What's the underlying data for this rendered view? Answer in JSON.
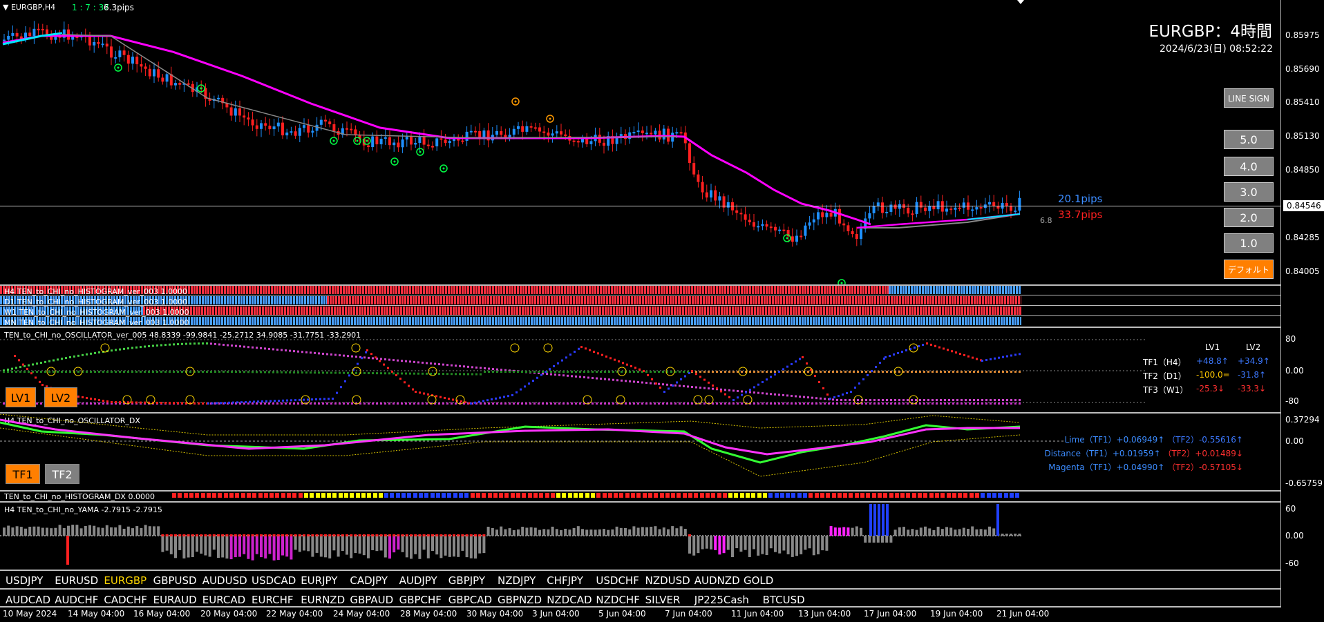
{
  "window": {
    "symbol_tf": "EURGBP,H4",
    "counter": "1 : 7 : 37",
    "pips": "6.3pips"
  },
  "header": {
    "title": "EURGBP：4時間",
    "datetime": "2024/6/23(日) 08:52:22"
  },
  "price_axis": [
    "0.85975",
    "0.85690",
    "0.85410",
    "0.85130",
    "0.84850",
    "0.84546",
    "0.84285",
    "0.84005"
  ],
  "current_price": "0.84546",
  "pips_labels": {
    "blue": "20.1pips",
    "red": "33.7pips",
    "gray": "6.8"
  },
  "buttons": {
    "line_sign": "LINE SIGN",
    "levels": [
      "5.0",
      "4.0",
      "3.0",
      "2.0",
      "1.0"
    ],
    "default": "デフォルト"
  },
  "histogram_rows": [
    {
      "label": "H4 TEN_to_CHI_no_HISTOGRAM_ver_003 1.0000"
    },
    {
      "label": "D1 TEN_to_CHI_no_HISTOGRAM_ver_003 1.0000"
    },
    {
      "label": "W1 TEN_to_CHI_no_HISTOGRAM_ver_003 1.0000"
    },
    {
      "label": "MN TEN_to_CHI_no_HISTOGRAM_ver_003 1.0000"
    }
  ],
  "oscillator": {
    "title": "TEN_to_CHI_no_OSCILLATOR_ver_005 48.8339 -99.9841 -25.2712 34.9085 -31.7751 -33.2901",
    "axis": [
      "80",
      "0.00",
      "-80"
    ],
    "lv_buttons": [
      "LV1",
      "LV2"
    ],
    "table_header": [
      "LV1",
      "LV2"
    ],
    "rows": [
      {
        "label": "TF1（H4）",
        "lv1": "+48.8↑",
        "lv2": "+34.9↑",
        "c1": "#3c78ff",
        "c2": "#3c78ff"
      },
      {
        "label": "TF2（D1）",
        "lv1": "-100.0=",
        "lv2": "-31.8↑",
        "c1": "#ffc800",
        "c2": "#3c78ff"
      },
      {
        "label": "TF3（W1）",
        "lv1": "-25.3↓",
        "lv2": "-33.3↓",
        "c1": "#ff3030",
        "c2": "#ff3030"
      }
    ]
  },
  "dx": {
    "title": "H4 TEN_to_CHI_no_OSCILLATOR_DX",
    "axis": [
      "0.37294",
      "0.00",
      "-0.65759"
    ],
    "tf_buttons": [
      "TF1",
      "TF2"
    ],
    "rows": [
      {
        "name": "Lime（TF1）",
        "tf1": "+0.06949↑",
        "tf2": "（TF2）-0.55616↑",
        "c2": "#3c78ff"
      },
      {
        "name": "Distance（TF1）",
        "tf1": "+0.01959↑",
        "tf2": "（TF2）+0.01489↓",
        "c2": "#ff3030"
      },
      {
        "name": "Magenta（TF1）",
        "tf1": "+0.04990↑",
        "tf2": "（TF2）-0.57105↓",
        "c2": "#ff3030"
      }
    ]
  },
  "histogram_dx": {
    "title": "TEN_to_CHI_no_HISTOGRAM_DX 0.0000"
  },
  "yama": {
    "title": "H4 TEN_to_CHI_no_YAMA -2.7915 -2.7915",
    "axis": [
      "60",
      "0.00",
      "-60"
    ]
  },
  "symbols_row1": [
    "USDJPY",
    "EURUSD",
    "EURGBP",
    "GBPUSD",
    "AUDUSD",
    "USDCAD",
    "EURJPY",
    "CADJPY",
    "AUDJPY",
    "GBPJPY",
    "NZDJPY",
    "CHFJPY",
    "USDCHF",
    "NZDUSD",
    "AUDNZD",
    "GOLD"
  ],
  "symbols_row2": [
    "AUDCAD",
    "AUDCHF",
    "CADCHF",
    "EURAUD",
    "EURCAD",
    "EURCHF",
    "EURNZD",
    "GBPAUD",
    "GBPCHF",
    "GBPCAD",
    "GBPNZD",
    "NZDCAD",
    "NZDCHF",
    "SILVER",
    "JP225Cash",
    "BTCUSD"
  ],
  "active_symbol": "EURGBP",
  "time_axis": [
    "10 May 2024",
    "14 May 04:00",
    "16 May 04:00",
    "20 May 04:00",
    "22 May 04:00",
    "24 May 04:00",
    "28 May 04:00",
    "30 May 04:00",
    "3 Jun 04:00",
    "5 Jun 04:00",
    "7 Jun 04:00",
    "11 Jun 04:00",
    "13 Jun 04:00",
    "17 Jun 04:00",
    "19 Jun 04:00",
    "21 Jun 04:00"
  ],
  "colors": {
    "bull": "#1e90ff",
    "bear": "#ff2020",
    "ma": "#ff00ff",
    "cyan": "#00e5ff",
    "accent": "#ff7f00"
  }
}
